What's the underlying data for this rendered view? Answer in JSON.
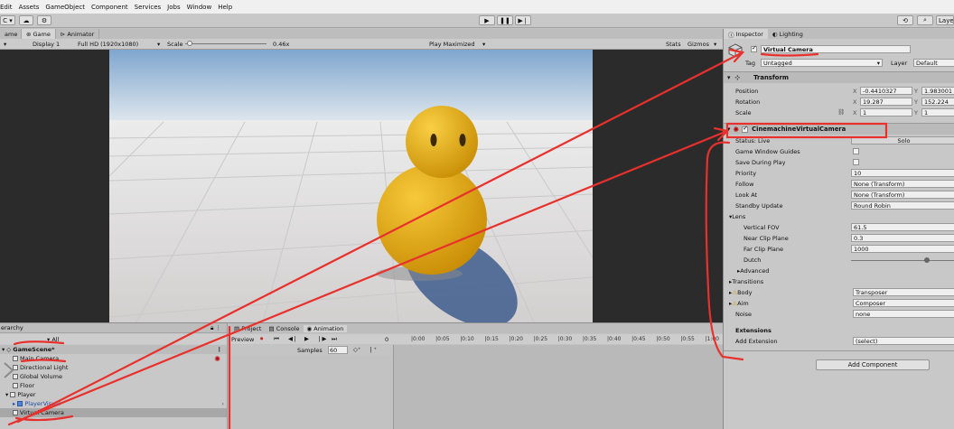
{
  "menu": [
    "Edit",
    "Assets",
    "GameObject",
    "Component",
    "Services",
    "Jobs",
    "Window",
    "Help"
  ],
  "toolbar": {
    "account": "C ▾",
    "cloud_icon": "cloud-icon",
    "settings_icon": "settings-icon",
    "play_icon": "play-icon",
    "pause_icon": "pause-icon",
    "step_icon": "step-icon",
    "history_icon": "history-icon",
    "search_icon": "search-icon",
    "layers_label": "Layers"
  },
  "game_tabs": [
    "ame",
    "Game",
    "Animator"
  ],
  "game_toolbar": {
    "display": "Display 1",
    "resolution": "Full HD (1920x1080)",
    "scale_label": "Scale",
    "scale_value": "0.46x",
    "play_mode": "Play Maximized",
    "stats": "Stats",
    "gizmos": "Gizmos"
  },
  "hierarchy": {
    "title": "erarchy",
    "search_prefix": "▾ All",
    "scene": "GameScene*",
    "items": [
      "Main Camera",
      "Directional Light",
      "Global Volume",
      "Floor",
      "Player",
      "PlayerVisual",
      "Virtual Camera"
    ]
  },
  "bottom_tabs": [
    "Project",
    "Console",
    "Animation"
  ],
  "animation": {
    "preview": "Preview",
    "samples_label": "Samples",
    "samples_value": "60",
    "frame": "0",
    "timeline_ticks": [
      "0:00",
      "0:05",
      "0:10",
      "0:15",
      "0:20",
      "0:25",
      "0:30",
      "0:35",
      "0:40",
      "0:45",
      "0:50",
      "0:55",
      "1:00"
    ]
  },
  "inspector": {
    "tabs": [
      "Inspector",
      "Lighting"
    ],
    "object_name": "Virtual Camera",
    "tag_label": "Tag",
    "tag_value": "Untagged",
    "layer_label": "Layer",
    "layer_value": "Default",
    "transform_title": "Transform",
    "position_label": "Position",
    "position_x": "-0.4410327",
    "position_y": "1.983001",
    "rotation_label": "Rotation",
    "rotation_x": "19.287",
    "rotation_y": "152.224",
    "scale_label": "Scale",
    "scale_x": "1",
    "scale_y": "1",
    "cvc_title": "CinemachineVirtualCamera",
    "status_label": "Status: Live",
    "solo_label": "Solo",
    "game_window_guides": "Game Window Guides",
    "save_during_play": "Save During Play",
    "priority_label": "Priority",
    "priority_value": "10",
    "follow_label": "Follow",
    "follow_value": "None (Transform)",
    "lookat_label": "Look At",
    "lookat_value": "None (Transform)",
    "standby_label": "Standby Update",
    "standby_value": "Round Robin",
    "lens_label": "Lens",
    "fov_label": "Vertical FOV",
    "fov_value": "61.5",
    "near_label": "Near Clip Plane",
    "near_value": "0.3",
    "far_label": "Far Clip Plane",
    "far_value": "1000",
    "dutch_label": "Dutch",
    "advanced_label": "Advanced",
    "transitions_label": "Transitions",
    "body_label": "Body",
    "body_value": "Transposer",
    "aim_label": "Aim",
    "aim_value": "Composer",
    "noise_label": "Noise",
    "noise_value": "none",
    "extensions_label": "Extensions",
    "add_extension_label": "Add Extension",
    "add_extension_value": "(select)",
    "add_component": "Add Component"
  },
  "colors": {
    "annotation": "#e8302c",
    "selection": "#3d6db8",
    "sky": "#b8d0e8",
    "floor": "#e4e4e4",
    "character": "#e8b317"
  }
}
